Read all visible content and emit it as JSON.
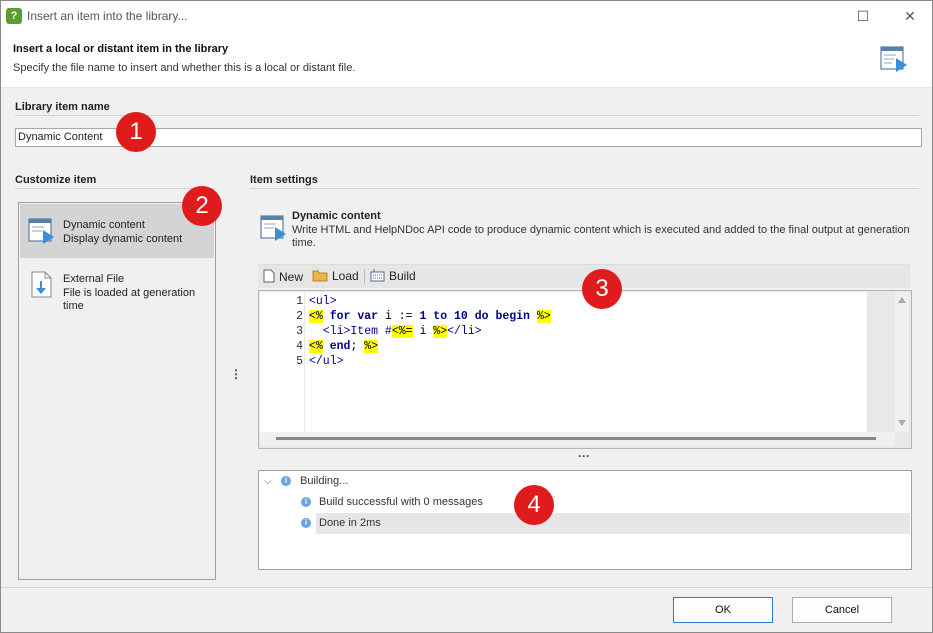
{
  "window": {
    "title": "Insert an item into the library...",
    "maximize_icon": "maximize-icon",
    "close_icon": "close-icon"
  },
  "header": {
    "title": "Insert a local or distant item in the library",
    "subtitle": "Specify the file name to insert and whether this is a local or distant file."
  },
  "library_name": {
    "section_label": "Library item name",
    "value": "Dynamic Content"
  },
  "customize": {
    "section_label": "Customize item",
    "items": [
      {
        "title": "Dynamic content",
        "description": "Display dynamic content",
        "selected": true,
        "icon": "dynamic-content-icon"
      },
      {
        "title": "External File",
        "description": "File is loaded at generation time",
        "selected": false,
        "icon": "external-file-icon"
      }
    ]
  },
  "settings": {
    "section_label": "Item settings",
    "heading": "Dynamic content",
    "description": "Write HTML and HelpNDoc API code to produce dynamic content which is executed and added to the final output at generation time."
  },
  "toolbar": {
    "new_label": "New",
    "load_label": "Load",
    "build_label": "Build"
  },
  "editor": {
    "line_numbers": [
      "1",
      "2",
      "3",
      "4",
      "5"
    ],
    "lines": [
      "<ul>",
      "<% for var i := 1 to 10 do begin %>",
      "  <li>Item #<%= i %></li>",
      "<% end; %>",
      "</ul>"
    ]
  },
  "output": {
    "root": "Building...",
    "messages": [
      "Build successful with 0 messages",
      "Done in 2ms"
    ]
  },
  "annotations": [
    "1",
    "2",
    "3",
    "4"
  ],
  "buttons": {
    "ok": "OK",
    "cancel": "Cancel"
  },
  "colors": {
    "badge": "#e01b1b",
    "selection": "#d4d4d4",
    "highlight": "#ffff00",
    "ok_border": "#2a7bd3"
  }
}
